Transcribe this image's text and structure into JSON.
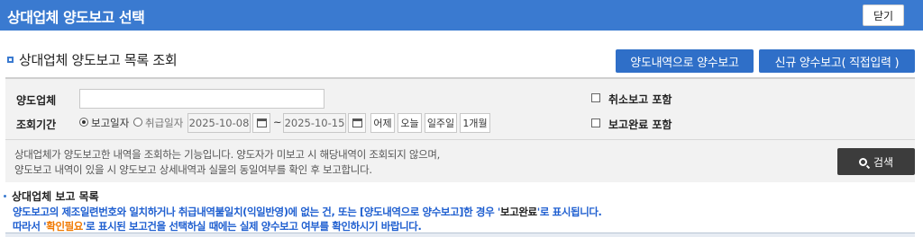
{
  "window": {
    "title": "상대업체 양도보고 선택",
    "close_label": "닫기"
  },
  "section": {
    "title": "상대업체 양도보고 목록 조회",
    "btn_yangdo_label": "양도내역으로 양수보고",
    "btn_new_label": "신규 양수보고( 직접입력 )"
  },
  "search": {
    "company_label": "양도업체",
    "company_value": "",
    "period_label": "조회기간",
    "radio_report_date": "보고일자",
    "radio_handle_date": "취급일자",
    "date_from": "2025-10-08",
    "date_sep": "~",
    "date_to": "2025-10-15",
    "quick_buttons": [
      "어제",
      "오늘",
      "일주일",
      "1개월"
    ],
    "include_cancel_label": "취소보고 포함",
    "include_complete_label": "보고완료 포함",
    "desc_line1": "상대업체가 양도보고한 내역을 조회하는 기능입니다. 양도자가 미보고 시 해당내역이 조회되지 않으며,",
    "desc_line2": "양도보고 내역이 있을 시 양도보고 상세내역과 실물의 동일여부를 확인 후 보고합니다.",
    "search_label": "검색"
  },
  "list": {
    "title": "상대업체 보고 목록",
    "notice1_a": "양도보고의 제조일련번호와 일치하거나 취급내역불일치(익일반영)에 없는 건, 또는 [양도내역으로 양수보고]한 경우 '",
    "notice1_b": "보고완료",
    "notice1_c": "'로 표시됩니다.",
    "notice2_a": "따라서 '",
    "notice2_b": "확인필요",
    "notice2_c": "'로 표시된 보고건을 선택하실 때에는 실제 양수보고 여부를 확인하시기 바랍니다."
  },
  "colors": {
    "header_blue": "#3a7ad0",
    "button_blue": "#2f6fc8",
    "notice_blue": "#1f5fd0",
    "notice_orange": "#f07800"
  },
  "icons": {
    "calendar": "calendar-icon",
    "search": "search-icon"
  }
}
